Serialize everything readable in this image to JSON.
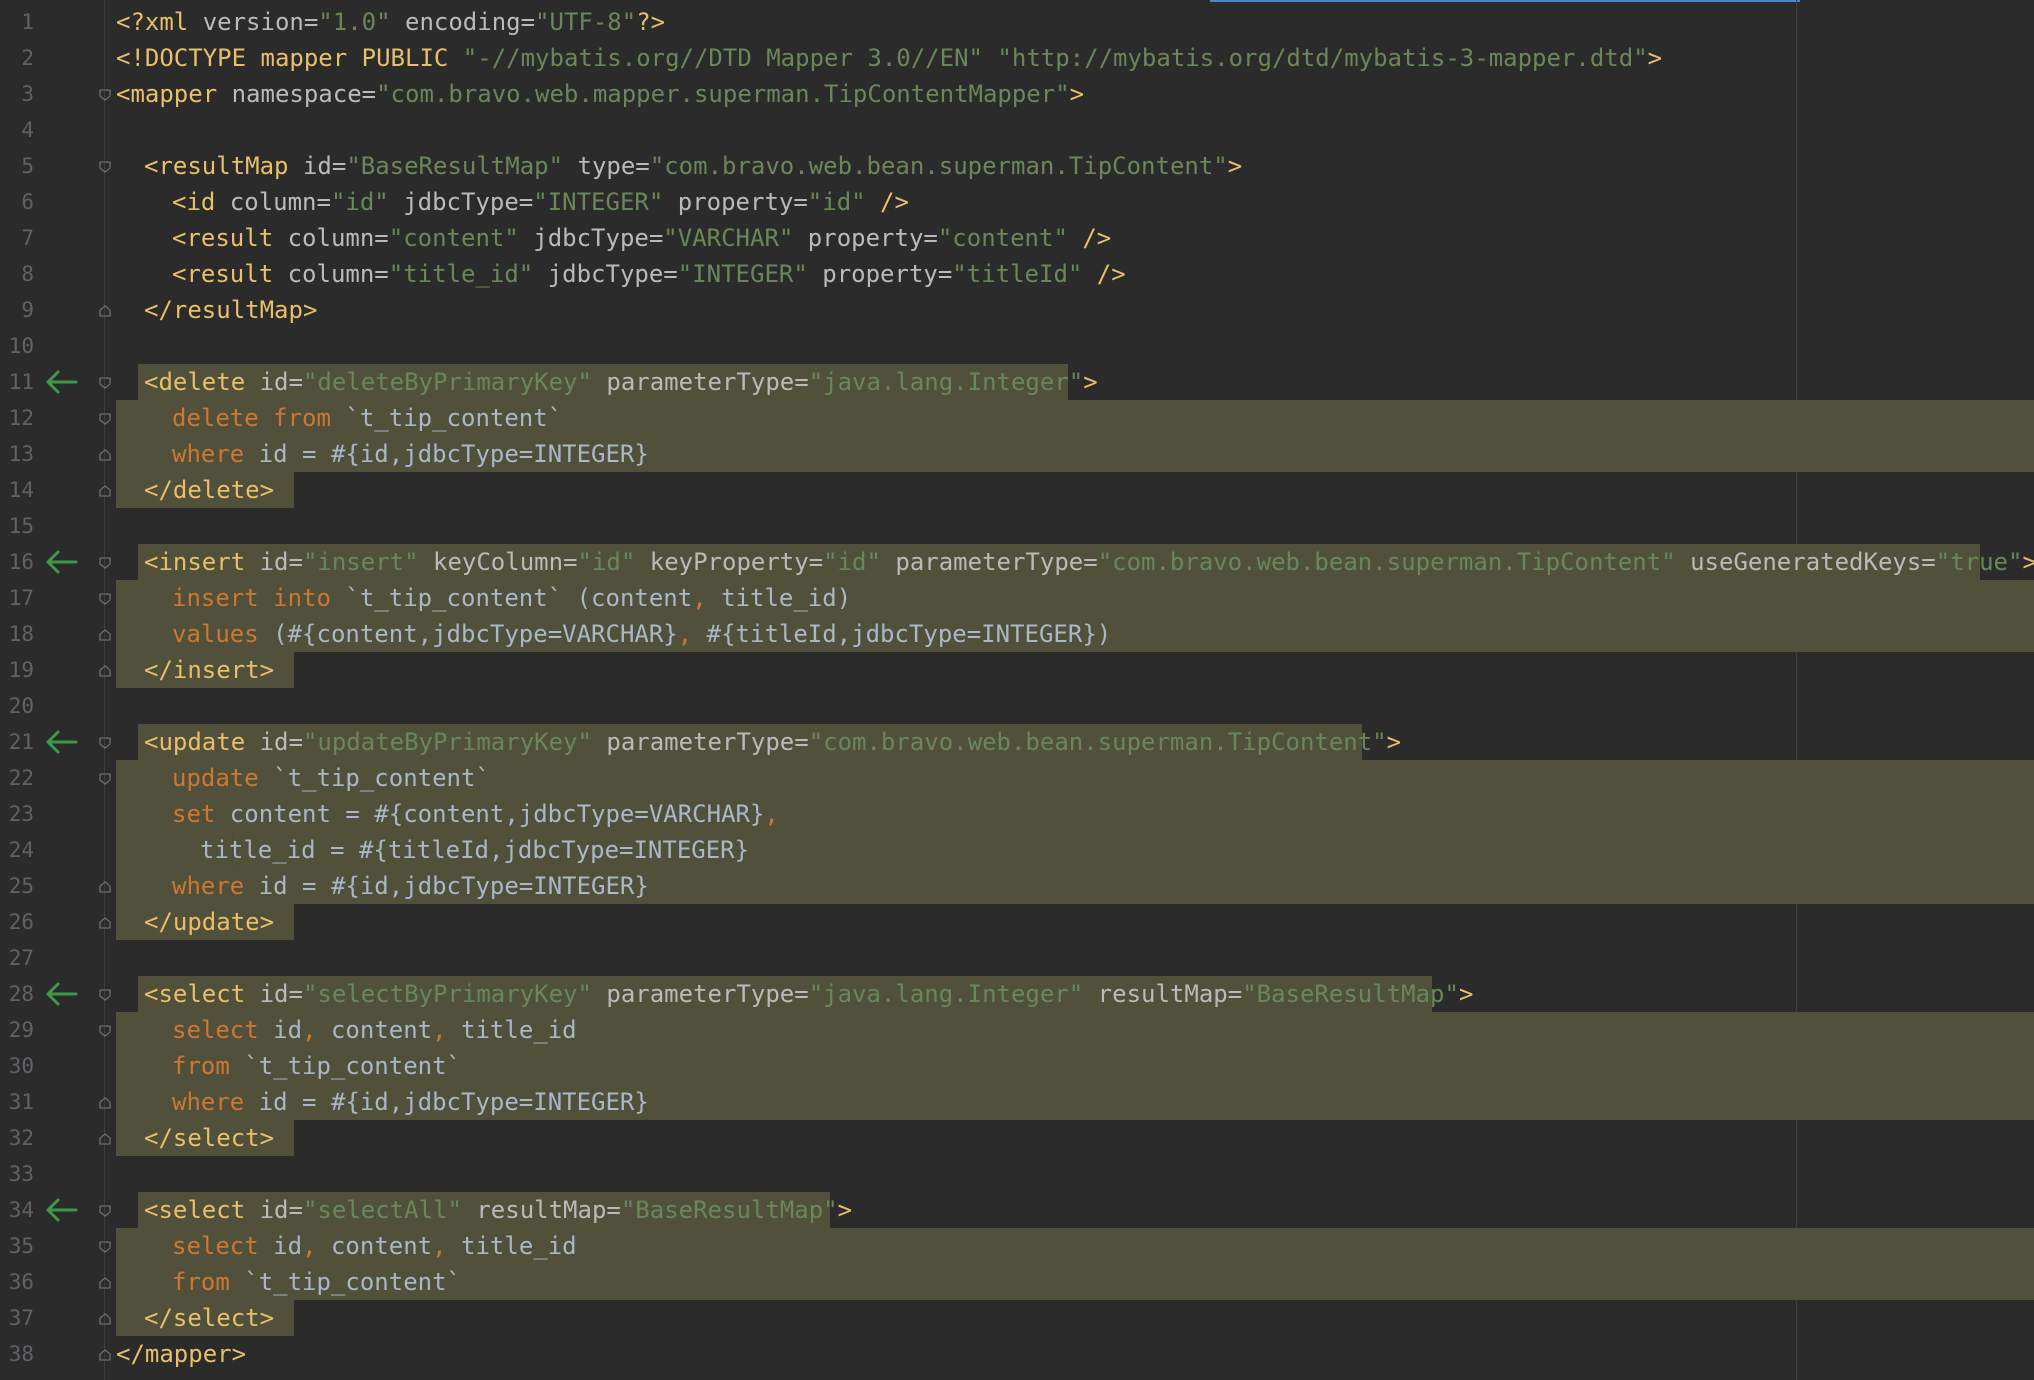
{
  "editor": {
    "language": "xml",
    "colors": {
      "background": "#2b2b2b",
      "gutter_number": "#606366",
      "highlight": "#51503b",
      "tag": "#e8bf6a",
      "attribute": "#bababa",
      "value": "#6a8759",
      "keyword": "#cc7832",
      "text": "#a9b7c6",
      "gutter_arrow": "#3c9a48"
    },
    "lines": [
      {
        "num": "1",
        "indent": 0,
        "marker": "",
        "fold": "",
        "segments": [
          {
            "t": "<?xml ",
            "c": "tag"
          },
          {
            "t": "version=",
            "c": "attr"
          },
          {
            "t": "\"1.0\"",
            "c": "val"
          },
          {
            "t": " encoding=",
            "c": "attr"
          },
          {
            "t": "\"UTF-8\"",
            "c": "val"
          },
          {
            "t": "?>",
            "c": "tag"
          }
        ]
      },
      {
        "num": "2",
        "indent": 0,
        "marker": "",
        "fold": "",
        "segments": [
          {
            "t": "<!DOCTYPE ",
            "c": "tag"
          },
          {
            "t": "mapper PUBLIC ",
            "c": "tag"
          },
          {
            "t": "\"-//mybatis.org//DTD Mapper 3.0//EN\"",
            "c": "val"
          },
          {
            "t": " ",
            "c": "txt"
          },
          {
            "t": "\"http://mybatis.org/dtd/mybatis-3-mapper.dtd\"",
            "c": "val"
          },
          {
            "t": ">",
            "c": "tag"
          }
        ]
      },
      {
        "num": "3",
        "indent": 0,
        "marker": "",
        "fold": "open",
        "segments": [
          {
            "t": "<mapper ",
            "c": "tag"
          },
          {
            "t": "namespace=",
            "c": "attr"
          },
          {
            "t": "\"com.bravo.web.mapper.superman.TipContentMapper\"",
            "c": "val"
          },
          {
            "t": ">",
            "c": "tag"
          }
        ]
      },
      {
        "num": "4",
        "indent": 0,
        "marker": "",
        "fold": "",
        "segments": []
      },
      {
        "num": "5",
        "indent": 1,
        "marker": "",
        "fold": "open",
        "segments": [
          {
            "t": "<resultMap ",
            "c": "tag"
          },
          {
            "t": "id=",
            "c": "attr"
          },
          {
            "t": "\"BaseResultMap\"",
            "c": "val"
          },
          {
            "t": " type=",
            "c": "attr"
          },
          {
            "t": "\"com.bravo.web.bean.superman.TipContent\"",
            "c": "val"
          },
          {
            "t": ">",
            "c": "tag"
          }
        ]
      },
      {
        "num": "6",
        "indent": 2,
        "marker": "",
        "fold": "",
        "segments": [
          {
            "t": "<id ",
            "c": "tag"
          },
          {
            "t": "column=",
            "c": "attr"
          },
          {
            "t": "\"id\"",
            "c": "val"
          },
          {
            "t": " jdbcType=",
            "c": "attr"
          },
          {
            "t": "\"INTEGER\"",
            "c": "val"
          },
          {
            "t": " property=",
            "c": "attr"
          },
          {
            "t": "\"id\"",
            "c": "val"
          },
          {
            "t": " />",
            "c": "tag"
          }
        ]
      },
      {
        "num": "7",
        "indent": 2,
        "marker": "",
        "fold": "",
        "segments": [
          {
            "t": "<result ",
            "c": "tag"
          },
          {
            "t": "column=",
            "c": "attr"
          },
          {
            "t": "\"content\"",
            "c": "val"
          },
          {
            "t": " jdbcType=",
            "c": "attr"
          },
          {
            "t": "\"VARCHAR\"",
            "c": "val"
          },
          {
            "t": " property=",
            "c": "attr"
          },
          {
            "t": "\"content\"",
            "c": "val"
          },
          {
            "t": " />",
            "c": "tag"
          }
        ]
      },
      {
        "num": "8",
        "indent": 2,
        "marker": "",
        "fold": "",
        "segments": [
          {
            "t": "<result ",
            "c": "tag"
          },
          {
            "t": "column=",
            "c": "attr"
          },
          {
            "t": "\"title_id\"",
            "c": "val"
          },
          {
            "t": " jdbcType=",
            "c": "attr"
          },
          {
            "t": "\"INTEGER\"",
            "c": "val"
          },
          {
            "t": " property=",
            "c": "attr"
          },
          {
            "t": "\"titleId\"",
            "c": "val"
          },
          {
            "t": " />",
            "c": "tag"
          }
        ]
      },
      {
        "num": "9",
        "indent": 1,
        "marker": "",
        "fold": "close",
        "segments": [
          {
            "t": "</resultMap>",
            "c": "tag"
          }
        ]
      },
      {
        "num": "10",
        "indent": 0,
        "marker": "",
        "fold": "",
        "segments": []
      },
      {
        "num": "11",
        "indent": 1,
        "marker": "arrow",
        "fold": "open",
        "hl": "start",
        "hl_end": 1068,
        "segments": [
          {
            "t": "<delete ",
            "c": "tag"
          },
          {
            "t": "id=",
            "c": "attr"
          },
          {
            "t": "\"deleteByPrimaryKey\"",
            "c": "val"
          },
          {
            "t": " parameterType=",
            "c": "attr"
          },
          {
            "t": "\"java.lang.Integer\"",
            "c": "val"
          },
          {
            "t": ">",
            "c": "tag"
          }
        ]
      },
      {
        "num": "12",
        "indent": 2,
        "marker": "",
        "fold": "open",
        "hl": "full",
        "segments": [
          {
            "t": "delete ",
            "c": "kw"
          },
          {
            "t": "from ",
            "c": "kw"
          },
          {
            "t": "`t_tip_content`",
            "c": "txt"
          }
        ]
      },
      {
        "num": "13",
        "indent": 2,
        "marker": "",
        "fold": "close",
        "hl": "full",
        "segments": [
          {
            "t": "where ",
            "c": "kw"
          },
          {
            "t": "id = #{id,jdbcType=INTEGER}",
            "c": "txt"
          }
        ]
      },
      {
        "num": "14",
        "indent": 1,
        "marker": "",
        "fold": "close",
        "hl": "end",
        "segments": [
          {
            "t": "</delete>",
            "c": "tag"
          }
        ]
      },
      {
        "num": "15",
        "indent": 0,
        "marker": "",
        "fold": "",
        "segments": []
      },
      {
        "num": "16",
        "indent": 1,
        "marker": "arrow",
        "fold": "open",
        "hl": "start",
        "hl_end": 1980,
        "segments": [
          {
            "t": "<insert ",
            "c": "tag"
          },
          {
            "t": "id=",
            "c": "attr"
          },
          {
            "t": "\"insert\"",
            "c": "val"
          },
          {
            "t": " keyColumn=",
            "c": "attr"
          },
          {
            "t": "\"id\"",
            "c": "val"
          },
          {
            "t": " keyProperty=",
            "c": "attr"
          },
          {
            "t": "\"id\"",
            "c": "val"
          },
          {
            "t": " parameterType=",
            "c": "attr"
          },
          {
            "t": "\"com.bravo.web.bean.superman.TipContent\"",
            "c": "val"
          },
          {
            "t": " useGeneratedKeys=",
            "c": "attr"
          },
          {
            "t": "\"true\"",
            "c": "val"
          },
          {
            "t": ">",
            "c": "tag"
          }
        ]
      },
      {
        "num": "17",
        "indent": 2,
        "marker": "",
        "fold": "open",
        "hl": "full",
        "segments": [
          {
            "t": "insert ",
            "c": "kw"
          },
          {
            "t": "into ",
            "c": "kw"
          },
          {
            "t": "`t_tip_content` (content",
            "c": "txt"
          },
          {
            "t": ", ",
            "c": "kw"
          },
          {
            "t": "title_id)",
            "c": "txt"
          }
        ]
      },
      {
        "num": "18",
        "indent": 2,
        "marker": "",
        "fold": "close",
        "hl": "full",
        "segments": [
          {
            "t": "values ",
            "c": "kw"
          },
          {
            "t": "(#{content,jdbcType=VARCHAR}",
            "c": "txt"
          },
          {
            "t": ", ",
            "c": "kw"
          },
          {
            "t": "#{titleId,jdbcType=INTEGER})",
            "c": "txt"
          }
        ]
      },
      {
        "num": "19",
        "indent": 1,
        "marker": "",
        "fold": "close",
        "hl": "end",
        "segments": [
          {
            "t": "</insert>",
            "c": "tag"
          }
        ]
      },
      {
        "num": "20",
        "indent": 0,
        "marker": "",
        "fold": "",
        "segments": []
      },
      {
        "num": "21",
        "indent": 1,
        "marker": "arrow",
        "fold": "open",
        "hl": "start",
        "hl_end": 1362,
        "segments": [
          {
            "t": "<update ",
            "c": "tag"
          },
          {
            "t": "id=",
            "c": "attr"
          },
          {
            "t": "\"updateByPrimaryKey\"",
            "c": "val"
          },
          {
            "t": " parameterType=",
            "c": "attr"
          },
          {
            "t": "\"com.bravo.web.bean.superman.TipContent\"",
            "c": "val"
          },
          {
            "t": ">",
            "c": "tag"
          }
        ]
      },
      {
        "num": "22",
        "indent": 2,
        "marker": "",
        "fold": "open",
        "hl": "full",
        "segments": [
          {
            "t": "update ",
            "c": "kw"
          },
          {
            "t": "`t_tip_content`",
            "c": "txt"
          }
        ]
      },
      {
        "num": "23",
        "indent": 2,
        "marker": "",
        "fold": "",
        "hl": "full",
        "segments": [
          {
            "t": "set ",
            "c": "kw"
          },
          {
            "t": "content = #{content,jdbcType=VARCHAR}",
            "c": "txt"
          },
          {
            "t": ",",
            "c": "kw"
          }
        ]
      },
      {
        "num": "24",
        "indent": 3,
        "marker": "",
        "fold": "",
        "hl": "full",
        "segments": [
          {
            "t": "title_id = #{titleId,jdbcType=INTEGER}",
            "c": "txt"
          }
        ]
      },
      {
        "num": "25",
        "indent": 2,
        "marker": "",
        "fold": "close",
        "hl": "full",
        "segments": [
          {
            "t": "where ",
            "c": "kw"
          },
          {
            "t": "id = #{id,jdbcType=INTEGER}",
            "c": "txt"
          }
        ]
      },
      {
        "num": "26",
        "indent": 1,
        "marker": "",
        "fold": "close",
        "hl": "end",
        "segments": [
          {
            "t": "</update>",
            "c": "tag"
          }
        ]
      },
      {
        "num": "27",
        "indent": 0,
        "marker": "",
        "fold": "",
        "segments": []
      },
      {
        "num": "28",
        "indent": 1,
        "marker": "arrow",
        "fold": "open",
        "hl": "start",
        "hl_end": 1432,
        "segments": [
          {
            "t": "<select ",
            "c": "tag"
          },
          {
            "t": "id=",
            "c": "attr"
          },
          {
            "t": "\"selectByPrimaryKey\"",
            "c": "val"
          },
          {
            "t": " parameterType=",
            "c": "attr"
          },
          {
            "t": "\"java.lang.Integer\"",
            "c": "val"
          },
          {
            "t": " resultMap=",
            "c": "attr"
          },
          {
            "t": "\"BaseResultMap\"",
            "c": "val"
          },
          {
            "t": ">",
            "c": "tag"
          }
        ]
      },
      {
        "num": "29",
        "indent": 2,
        "marker": "",
        "fold": "open",
        "hl": "full",
        "segments": [
          {
            "t": "select ",
            "c": "kw"
          },
          {
            "t": "id",
            "c": "txt"
          },
          {
            "t": ", ",
            "c": "kw"
          },
          {
            "t": "content",
            "c": "txt"
          },
          {
            "t": ", ",
            "c": "kw"
          },
          {
            "t": "title_id",
            "c": "txt"
          }
        ]
      },
      {
        "num": "30",
        "indent": 2,
        "marker": "",
        "fold": "",
        "hl": "full",
        "segments": [
          {
            "t": "from ",
            "c": "kw"
          },
          {
            "t": "`t_tip_content`",
            "c": "txt"
          }
        ]
      },
      {
        "num": "31",
        "indent": 2,
        "marker": "",
        "fold": "close",
        "hl": "full",
        "segments": [
          {
            "t": "where ",
            "c": "kw"
          },
          {
            "t": "id = #{id,jdbcType=INTEGER}",
            "c": "txt"
          }
        ]
      },
      {
        "num": "32",
        "indent": 1,
        "marker": "",
        "fold": "close",
        "hl": "end",
        "segments": [
          {
            "t": "</select>",
            "c": "tag"
          }
        ]
      },
      {
        "num": "33",
        "indent": 0,
        "marker": "",
        "fold": "",
        "segments": []
      },
      {
        "num": "34",
        "indent": 1,
        "marker": "arrow",
        "fold": "open",
        "hl": "start",
        "hl_end": 830,
        "segments": [
          {
            "t": "<select ",
            "c": "tag"
          },
          {
            "t": "id=",
            "c": "attr"
          },
          {
            "t": "\"selectAll\"",
            "c": "val"
          },
          {
            "t": " resultMap=",
            "c": "attr"
          },
          {
            "t": "\"BaseResultMap\"",
            "c": "val"
          },
          {
            "t": ">",
            "c": "tag"
          }
        ]
      },
      {
        "num": "35",
        "indent": 2,
        "marker": "",
        "fold": "open",
        "hl": "full",
        "segments": [
          {
            "t": "select ",
            "c": "kw"
          },
          {
            "t": "id",
            "c": "txt"
          },
          {
            "t": ", ",
            "c": "kw"
          },
          {
            "t": "content",
            "c": "txt"
          },
          {
            "t": ", ",
            "c": "kw"
          },
          {
            "t": "title_id",
            "c": "txt"
          }
        ]
      },
      {
        "num": "36",
        "indent": 2,
        "marker": "",
        "fold": "close",
        "hl": "full",
        "segments": [
          {
            "t": "from ",
            "c": "kw"
          },
          {
            "t": "`t_tip_content`",
            "c": "txt"
          }
        ]
      },
      {
        "num": "37",
        "indent": 1,
        "marker": "",
        "fold": "close",
        "hl": "end",
        "segments": [
          {
            "t": "</select>",
            "c": "tag"
          }
        ]
      },
      {
        "num": "38",
        "indent": 0,
        "marker": "",
        "fold": "close",
        "segments": [
          {
            "t": "</mapper>",
            "c": "tag"
          }
        ]
      }
    ]
  }
}
